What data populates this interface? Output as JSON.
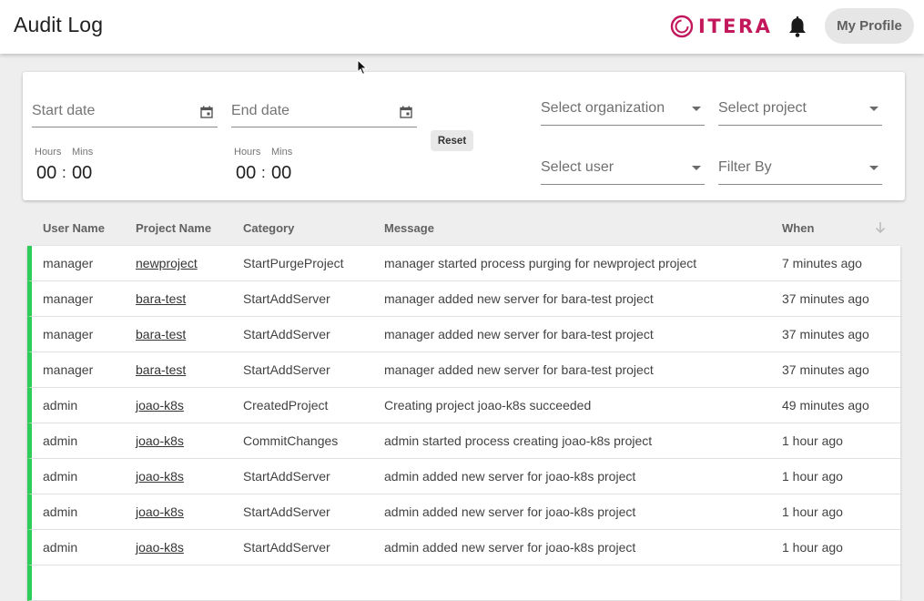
{
  "header": {
    "title": "Audit Log",
    "logo_text": "ITERA",
    "profile_label": "My Profile"
  },
  "colors": {
    "brand": "#c2185b",
    "status_bar": "#2ecc58",
    "background": "#eeeeee"
  },
  "filters": {
    "start_date_placeholder": "Start date",
    "end_date_placeholder": "End date",
    "start_time": {
      "hours_label": "Hours",
      "mins_label": "Mins",
      "hours": "00",
      "mins": "00",
      "separator": ":"
    },
    "end_time": {
      "hours_label": "Hours",
      "mins_label": "Mins",
      "hours": "00",
      "mins": "00",
      "separator": ":"
    },
    "reset_label": "Reset",
    "organization_placeholder": "Select organization",
    "project_placeholder": "Select project",
    "user_placeholder": "Select user",
    "filter_by_placeholder": "Filter By"
  },
  "table": {
    "columns": [
      "User Name",
      "Project Name",
      "Category",
      "Message",
      "When"
    ],
    "rows": [
      {
        "user": "manager",
        "project": "newproject",
        "category": "StartPurgeProject",
        "message": "manager started process purging for newproject project",
        "when": "7 minutes ago"
      },
      {
        "user": "manager",
        "project": "bara-test",
        "category": "StartAddServer",
        "message": "manager added new server for bara-test project",
        "when": "37 minutes ago"
      },
      {
        "user": "manager",
        "project": "bara-test",
        "category": "StartAddServer",
        "message": "manager added new server for bara-test project",
        "when": "37 minutes ago"
      },
      {
        "user": "manager",
        "project": "bara-test",
        "category": "StartAddServer",
        "message": "manager added new server for bara-test project",
        "when": "37 minutes ago"
      },
      {
        "user": "admin",
        "project": "joao-k8s",
        "category": "CreatedProject",
        "message": "Creating project joao-k8s succeeded",
        "when": "49 minutes ago"
      },
      {
        "user": "admin",
        "project": "joao-k8s",
        "category": "CommitChanges",
        "message": "admin started process creating joao-k8s project",
        "when": "1 hour ago"
      },
      {
        "user": "admin",
        "project": "joao-k8s",
        "category": "StartAddServer",
        "message": "admin added new server for joao-k8s project",
        "when": "1 hour ago"
      },
      {
        "user": "admin",
        "project": "joao-k8s",
        "category": "StartAddServer",
        "message": "admin added new server for joao-k8s project",
        "when": "1 hour ago"
      },
      {
        "user": "admin",
        "project": "joao-k8s",
        "category": "StartAddServer",
        "message": "admin added new server for joao-k8s project",
        "when": "1 hour ago"
      },
      {
        "user": "",
        "project": "",
        "category": "",
        "message": "",
        "when": ""
      }
    ]
  }
}
